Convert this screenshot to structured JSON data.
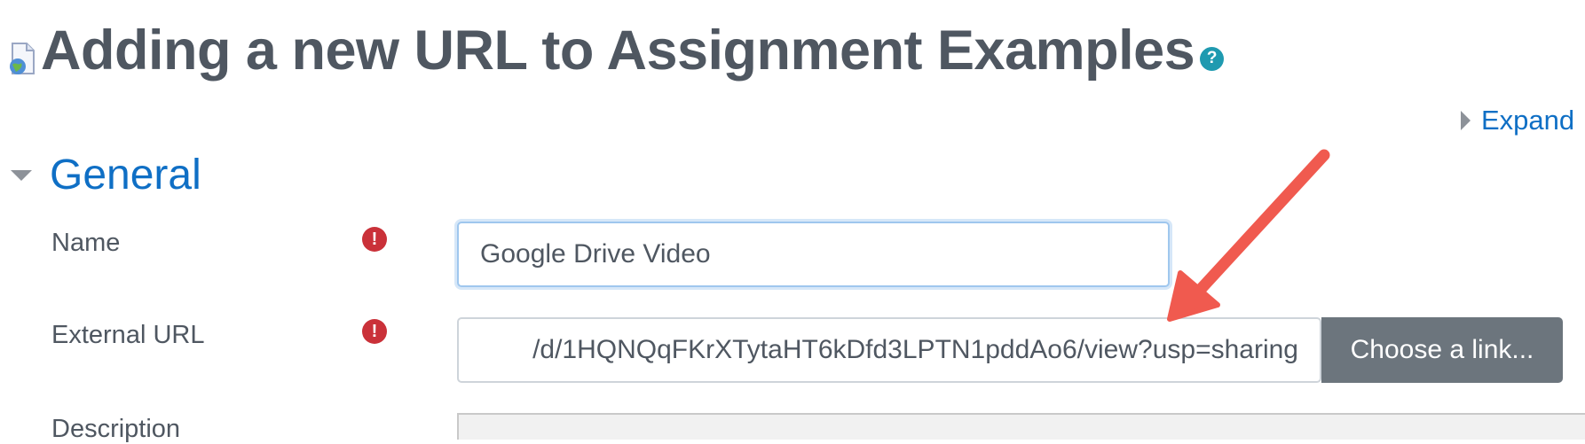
{
  "header": {
    "title": "Adding a new URL to Assignment Examples",
    "module_icon": "url-module-icon",
    "help_icon": "help-question-icon"
  },
  "expand_all": {
    "label": "Expand"
  },
  "section": {
    "title": "General",
    "collapse_icon": "triangle-down-icon"
  },
  "form": {
    "name": {
      "label": "Name",
      "value": "Google Drive Video",
      "required_icon": "exclamation-icon"
    },
    "external_url": {
      "label": "External URL",
      "value": "/d/1HQNQqFKrXTytaHT6kDfd3LPTN1pddAo6/view?usp=sharing",
      "required_icon": "exclamation-icon",
      "choose_button": "Choose a link..."
    },
    "description": {
      "label": "Description"
    }
  },
  "annotation": {
    "arrow_color": "#f05a4f"
  },
  "colors": {
    "link": "#0f6fc5",
    "required": "#ca3139",
    "help": "#1f9ab0",
    "button": "#6c757d"
  }
}
